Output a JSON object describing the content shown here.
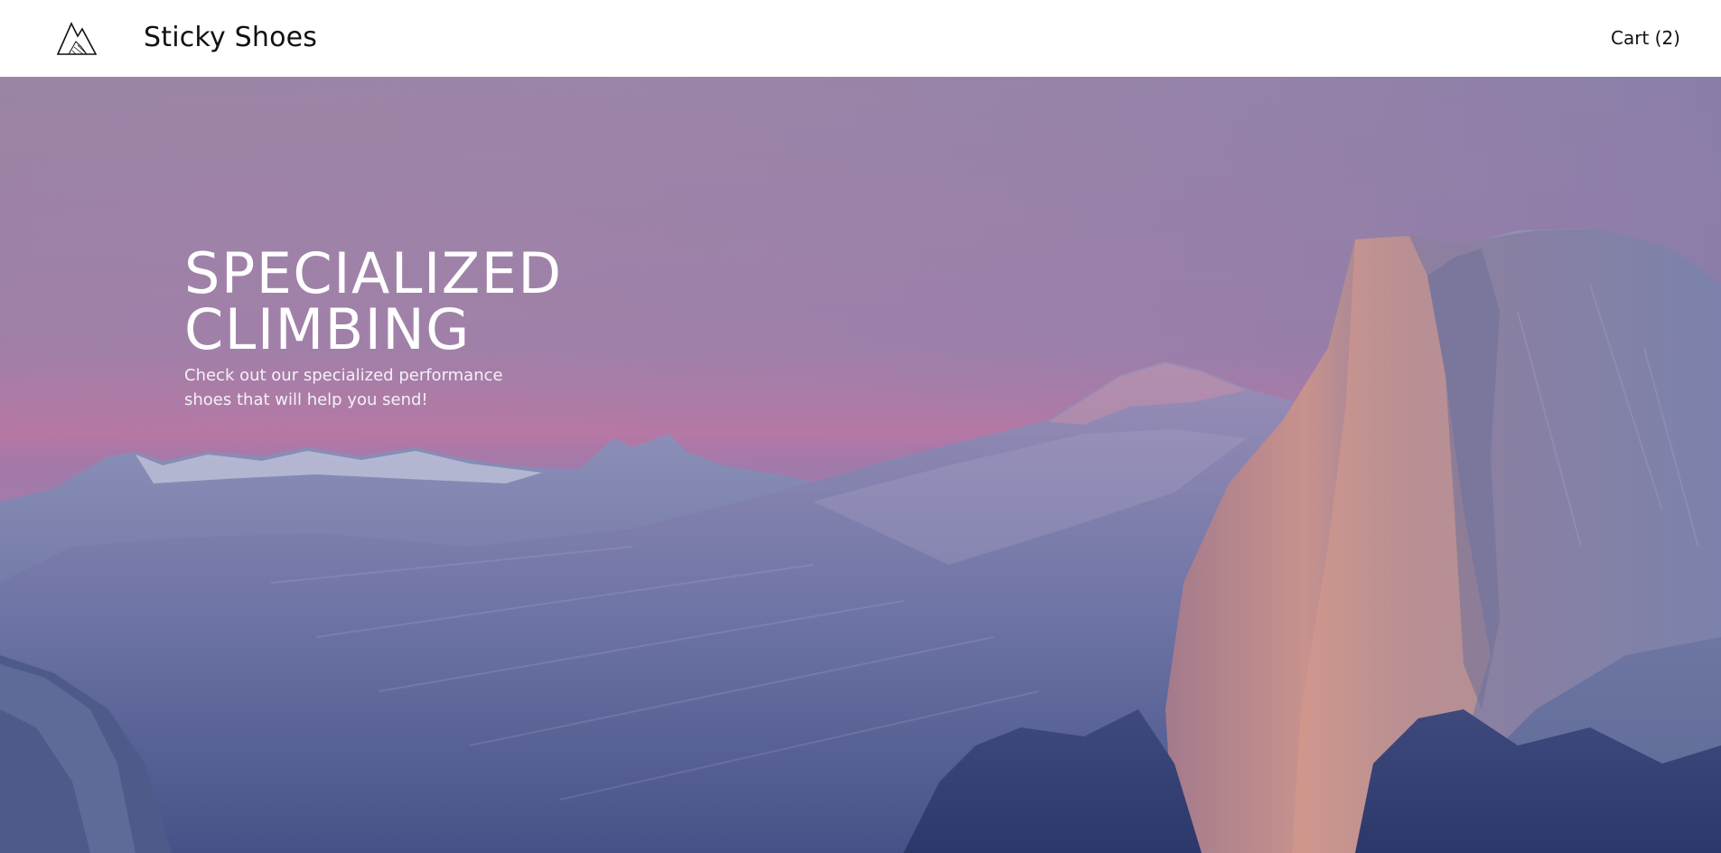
{
  "header": {
    "brand": "Sticky Shoes",
    "logo_icon": "mountain-logo-icon",
    "cart_label": "Cart (2)"
  },
  "hero": {
    "title": "SPECIALIZED CLIMBING",
    "subtitle": "Check out our specialized performance shoes that will help you send!",
    "background_image": "mountain-valley-dusk-photo"
  },
  "colors": {
    "header_bg": "#ffffff",
    "header_text": "#111111",
    "hero_text": "#ffffff",
    "sky_top": "#9b86a8",
    "sky_glow": "#b07aa6",
    "mountain": "#5f6a9e",
    "cliff_face": "#c58a8e"
  }
}
